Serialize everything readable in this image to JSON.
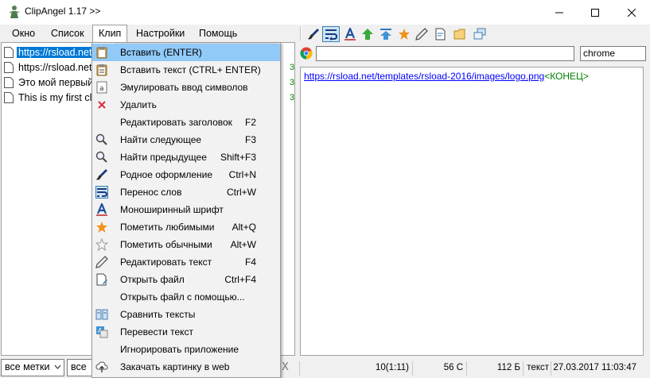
{
  "window": {
    "title": "ClipAngel 1.17 >>"
  },
  "menubar": [
    {
      "label": "Окно"
    },
    {
      "label": "Список"
    },
    {
      "label": "Клип"
    },
    {
      "label": "Настройки"
    },
    {
      "label": "Помощь"
    }
  ],
  "list": [
    {
      "text": "https://rsload.net",
      "num": "",
      "selected": true
    },
    {
      "text": "https://rsload.net",
      "num": "3",
      "selected": false
    },
    {
      "text": "Это мой первый",
      "num": "3",
      "selected": false
    },
    {
      "text": "This is my first cli",
      "num": "3",
      "selected": false
    }
  ],
  "toolbar_icons": [
    "brush-icon",
    "word-wrap-icon",
    "font-a-icon",
    "arrow-up-green-icon",
    "arrow-up-blue-icon",
    "star-icon",
    "pencil-icon",
    "edit-file-icon",
    "open-folder-icon",
    "window-copy-icon"
  ],
  "app_field": {
    "value": "chrome"
  },
  "url_field": {
    "value": ""
  },
  "editor": {
    "link": "https://rsload.net/templates/rsload-2016/images/logo.png",
    "end_tag": "<КОНЕЦ>"
  },
  "bottom": {
    "filter1": "все метки",
    "filter2": "все т",
    "x": "X",
    "position": "10(1:11)",
    "chars": "56 С",
    "size": "112 Б",
    "type": "текст",
    "datetime": "27.03.2017 11:03:47"
  },
  "dropdown": [
    {
      "icon": "paste-icon",
      "label": "Вставить (ENTER)",
      "shortcut": "",
      "hover": true
    },
    {
      "icon": "paste-text-icon",
      "label": "Вставить текст (CTRL+ ENTER)",
      "shortcut": ""
    },
    {
      "icon": "emulate-input-icon",
      "label": "Эмулировать ввод символов",
      "shortcut": ""
    },
    {
      "icon": "delete-icon",
      "label": "Удалить",
      "shortcut": ""
    },
    {
      "icon": "",
      "label": "Редактировать заголовок",
      "shortcut": "F2"
    },
    {
      "icon": "find-next-icon",
      "label": "Найти следующее",
      "shortcut": "F3"
    },
    {
      "icon": "find-prev-icon",
      "label": "Найти предыдущее",
      "shortcut": "Shift+F3"
    },
    {
      "icon": "brush-icon",
      "label": "Родное оформление",
      "shortcut": "Ctrl+N"
    },
    {
      "icon": "word-wrap-icon",
      "label": "Перенос слов",
      "shortcut": "Ctrl+W"
    },
    {
      "icon": "font-a-icon",
      "label": "Моноширинный шрифт",
      "shortcut": ""
    },
    {
      "icon": "star-icon",
      "label": "Пометить любимыми",
      "shortcut": "Alt+Q"
    },
    {
      "icon": "star-outline-icon",
      "label": "Пометить обычными",
      "shortcut": "Alt+W"
    },
    {
      "icon": "pencil-icon",
      "label": "Редактировать текст",
      "shortcut": "F4"
    },
    {
      "icon": "edit-file-icon",
      "label": "Открыть файл",
      "shortcut": "Ctrl+F4"
    },
    {
      "icon": "",
      "label": "Открыть файл с помощью...",
      "shortcut": ""
    },
    {
      "icon": "compare-icon",
      "label": "Сравнить тексты",
      "shortcut": ""
    },
    {
      "icon": "translate-icon",
      "label": "Перевести текст",
      "shortcut": ""
    },
    {
      "icon": "",
      "label": "Игнорировать приложение",
      "shortcut": ""
    },
    {
      "icon": "cloud-upload-icon",
      "label": "Закачать картинку в web",
      "shortcut": ""
    }
  ],
  "colors": {
    "selection": "#0078d7",
    "menu_hover": "#91c9f7",
    "link": "#0000ff",
    "green": "#008000"
  }
}
